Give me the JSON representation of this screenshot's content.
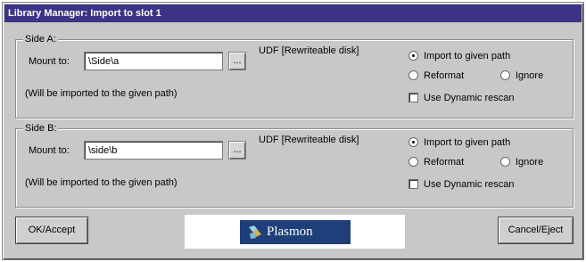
{
  "window": {
    "title": "Library Manager: Import to slot 1"
  },
  "side_a": {
    "legend": "Side A:",
    "mount_label": "Mount to:",
    "mount_value": "\\Side\\a",
    "browse_label": "...",
    "format_label": "UDF [Rewriteable disk]",
    "note": "(Will be imported to the given path)",
    "options": {
      "import_label": "Import to given path",
      "reformat_label": "Reformat",
      "ignore_label": "Ignore",
      "dynamic_rescan_label": "Use Dynamic rescan",
      "selected": "import",
      "dynamic_rescan_checked": false
    }
  },
  "side_b": {
    "legend": "Side B:",
    "mount_label": "Mount to:",
    "mount_value": "\\side\\b",
    "browse_label": "...",
    "format_label": "UDF [Rewriteable disk]",
    "note": "(Will be imported to the given path)",
    "options": {
      "import_label": "Import to given path",
      "reformat_label": "Reformat",
      "ignore_label": "Ignore",
      "dynamic_rescan_label": "Use Dynamic rescan",
      "selected": "import",
      "dynamic_rescan_checked": false
    }
  },
  "footer": {
    "ok_label": "OK/Accept",
    "cancel_label": "Cancel/Eject",
    "logo_text": "Plasmon",
    "logo_icon": "plasmon-logo-icon"
  },
  "colors": {
    "titlebar": "#3b3486",
    "dialog_face": "#c8c8c8",
    "logo_background": "#1e3f7a"
  }
}
